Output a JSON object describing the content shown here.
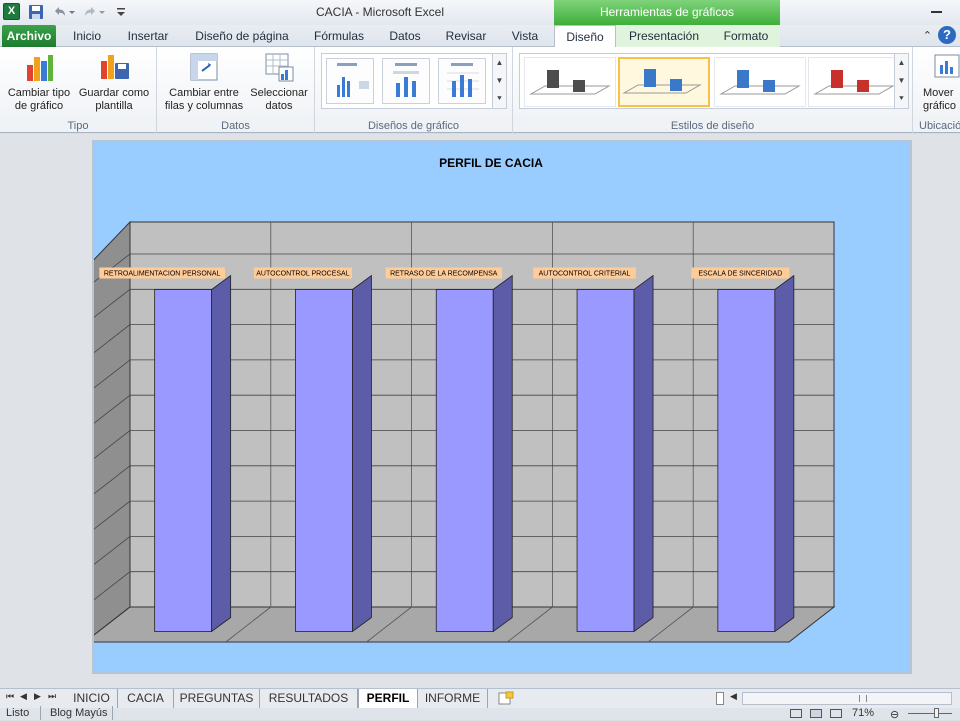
{
  "window": {
    "title": "CACIA  -  Microsoft Excel",
    "tools_title": "Herramientas de gráficos"
  },
  "tabs": [
    {
      "label": "Archivo"
    },
    {
      "label": "Inicio"
    },
    {
      "label": "Insertar"
    },
    {
      "label": "Diseño de página"
    },
    {
      "label": "Fórmulas"
    },
    {
      "label": "Datos"
    },
    {
      "label": "Revisar"
    },
    {
      "label": "Vista"
    },
    {
      "label": "Diseño"
    },
    {
      "label": "Presentación"
    },
    {
      "label": "Formato"
    }
  ],
  "active_tab": "Diseño",
  "help_glyph": "?",
  "ribbon": {
    "tipo": {
      "label": "Tipo",
      "change_type": [
        "Cambiar tipo",
        "de gráfico"
      ],
      "save_template": [
        "Guardar como",
        "plantilla"
      ]
    },
    "datos": {
      "label": "Datos",
      "switch_rows": [
        "Cambiar entre",
        "filas y columnas"
      ],
      "select_data": [
        "Seleccionar",
        "datos"
      ]
    },
    "layouts": {
      "label": "Diseños de gráfico"
    },
    "styles": {
      "label": "Estilos de diseño"
    },
    "ubicacion": {
      "label": "Ubicació",
      "move_chart": [
        "Mover",
        "gráfico"
      ]
    }
  },
  "chart_data": {
    "type": "bar",
    "title": "PERFIL DE CACIA",
    "categories": [
      "RETROALIMENTACION PERSONAL",
      "AUTOCONTROL PROCESAL",
      "RETRASO DE LA RECOMPENSA",
      "AUTOCONTROL CRITERIAL",
      "ESCALA DE SINCERIDAD"
    ],
    "values": [
      1,
      1,
      1,
      1,
      1
    ],
    "yticks": [
      "0",
      "0.1",
      "0.2",
      "0.3",
      "0.4",
      "0.5",
      "0.6",
      "0.7",
      "0.8",
      "0.9",
      "1"
    ],
    "ylim": [
      0,
      1
    ],
    "grid": true,
    "style": "3d-column",
    "colors": {
      "bar_front": "#9999ff",
      "bar_side": "#5c5ca8",
      "wall": "#c0c0c0",
      "floor": "#a8a8a8",
      "chart_background": "#99ccff",
      "label_background": "#ffcc99"
    }
  },
  "sheet_tabs": [
    "INICIO",
    "CACIA",
    "PREGUNTAS",
    "RESULTADOS",
    "PERFIL",
    "INFORME"
  ],
  "active_sheet": "PERFIL",
  "status": {
    "ready": "Listo",
    "blog": "Blog Mayús",
    "zoom": "71%"
  }
}
